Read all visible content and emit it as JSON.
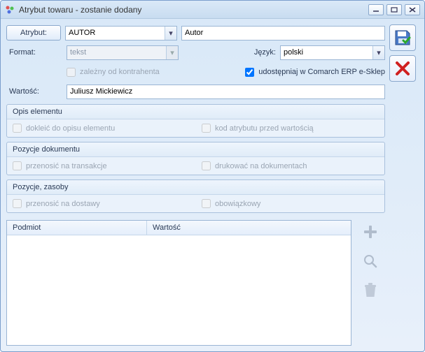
{
  "window": {
    "title": "Atrybut towaru - zostanie dodany"
  },
  "attribute": {
    "button_label": "Atrybut:",
    "combo_value": "AUTOR",
    "name_value": "Autor"
  },
  "format": {
    "label": "Format:",
    "combo_value": "tekst",
    "lang_label": "Język:",
    "lang_value": "polski"
  },
  "options": {
    "dependent_label": "zależny od kontrahenta",
    "eshop_label": "udostępniaj w Comarch ERP e-Sklep"
  },
  "value": {
    "label": "Wartość:",
    "text": "Juliusz Mickiewicz"
  },
  "group_opis": {
    "title": "Opis elementu",
    "opt1": "dokleić do opisu elementu",
    "opt2": "kod atrybutu przed wartością"
  },
  "group_poz": {
    "title": "Pozycje dokumentu",
    "opt1": "przenosić na transakcje",
    "opt2": "drukować na dokumentach"
  },
  "group_zas": {
    "title": "Pozycje, zasoby",
    "opt1": "przenosić na dostawy",
    "opt2": "obowiązkowy"
  },
  "table": {
    "col1": "Podmiot",
    "col2": "Wartość"
  }
}
